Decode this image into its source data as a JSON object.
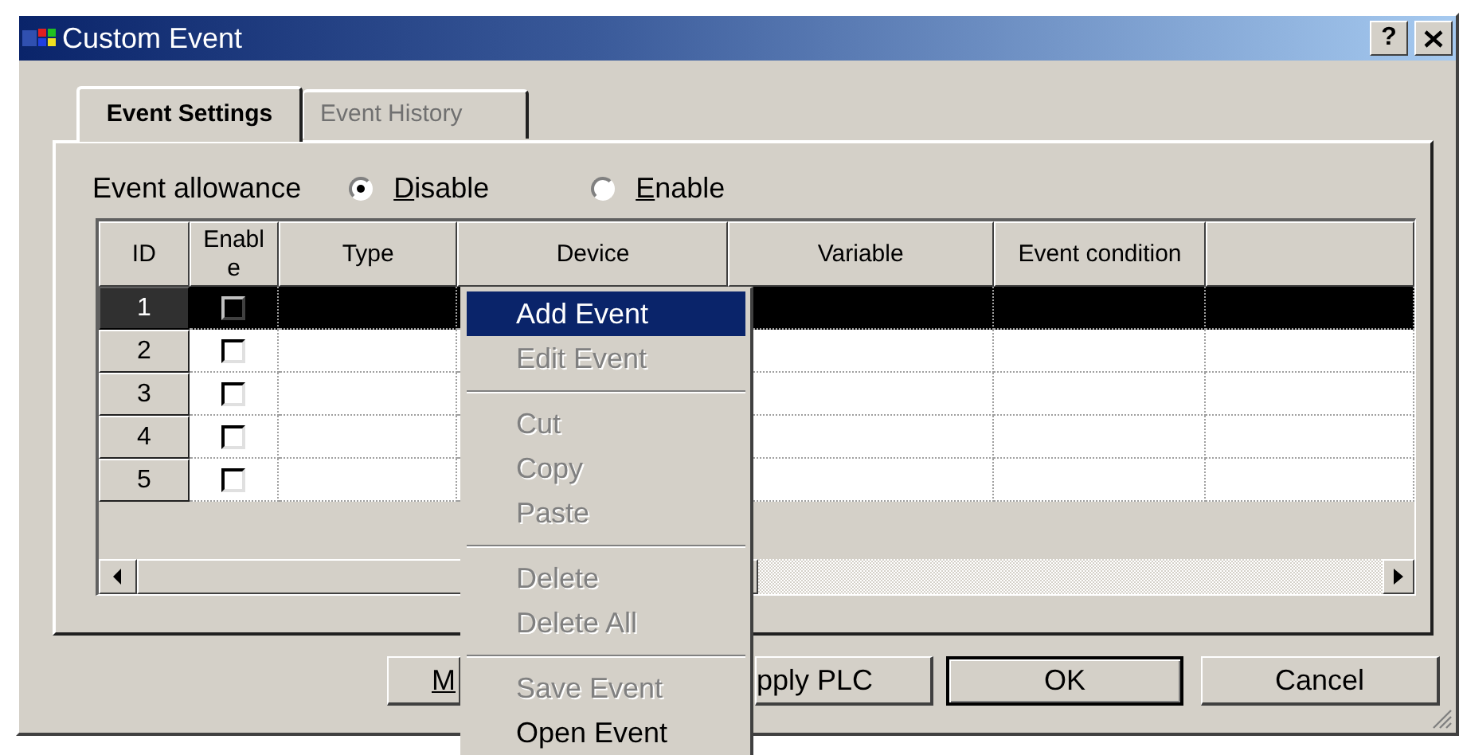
{
  "window": {
    "title": "Custom Event",
    "help_button": "?"
  },
  "tabs": [
    {
      "label": "Event Settings",
      "selected": true
    },
    {
      "label": "Event History",
      "selected": false
    }
  ],
  "event_allowance": {
    "label": "Event allowance",
    "options": [
      {
        "label": "Disable",
        "selected": true,
        "mnemonic_underlined": true
      },
      {
        "label": "Enable",
        "selected": false,
        "mnemonic_underlined": true
      }
    ]
  },
  "table": {
    "columns": [
      "ID",
      "Enable",
      "Type",
      "Device",
      "Variable",
      "Event condition"
    ],
    "rows": [
      {
        "id": "1",
        "enabled": false,
        "selected": true
      },
      {
        "id": "2",
        "enabled": false,
        "selected": false
      },
      {
        "id": "3",
        "enabled": false,
        "selected": false
      },
      {
        "id": "4",
        "enabled": false,
        "selected": false
      },
      {
        "id": "5",
        "enabled": false,
        "selected": false
      }
    ]
  },
  "buttons": [
    {
      "label": "M",
      "default": false,
      "mnemonic_underlined": true
    },
    {
      "label": "pply PLC",
      "default": false,
      "mnemonic_underlined": false
    },
    {
      "label": "OK",
      "default": true,
      "mnemonic_underlined": false
    },
    {
      "label": "Cancel",
      "default": false,
      "mnemonic_underlined": false
    }
  ],
  "context_menu": {
    "items": [
      {
        "kind": "item",
        "label": "Add Event",
        "selected": true,
        "disabled": false
      },
      {
        "kind": "item",
        "label": "Edit Event",
        "selected": false,
        "disabled": true
      },
      {
        "kind": "separator"
      },
      {
        "kind": "item",
        "label": "Cut",
        "selected": false,
        "disabled": true
      },
      {
        "kind": "item",
        "label": "Copy",
        "selected": false,
        "disabled": true
      },
      {
        "kind": "item",
        "label": "Paste",
        "selected": false,
        "disabled": true
      },
      {
        "kind": "separator"
      },
      {
        "kind": "item",
        "label": "Delete",
        "selected": false,
        "disabled": true
      },
      {
        "kind": "item",
        "label": "Delete All",
        "selected": false,
        "disabled": true
      },
      {
        "kind": "separator"
      },
      {
        "kind": "item",
        "label": "Save Event",
        "selected": false,
        "disabled": true
      },
      {
        "kind": "item",
        "label": "Open Event",
        "selected": false,
        "disabled": false
      }
    ]
  }
}
